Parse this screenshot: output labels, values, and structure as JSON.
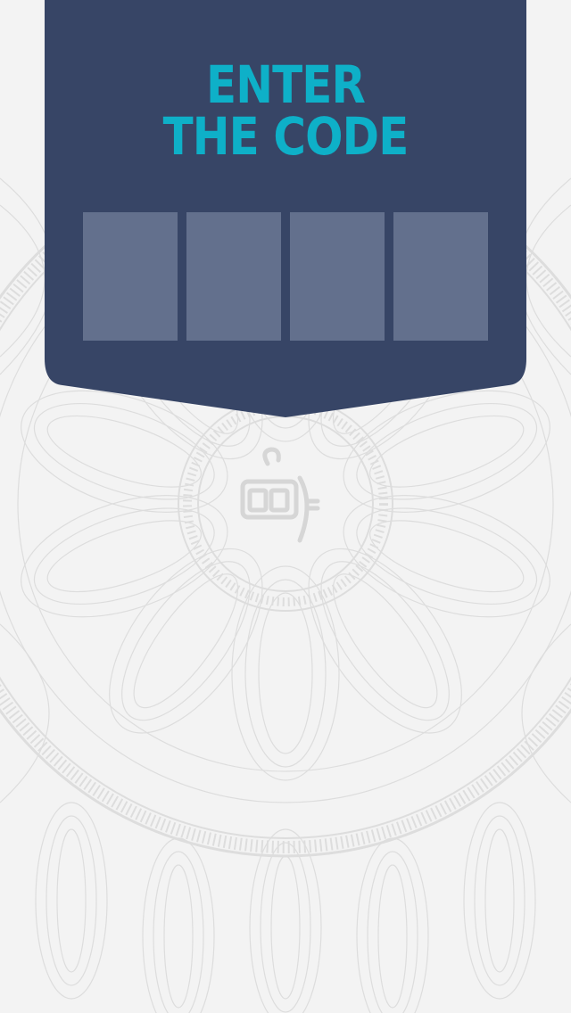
{
  "screen": {
    "title_line1": "ENTER",
    "title_line2": "THE CODE"
  },
  "code_input": {
    "digits": [
      "",
      "",
      "",
      ""
    ]
  },
  "emblem": {
    "icon": "slot-machine-icon"
  },
  "colors": {
    "background": "#f3f3f3",
    "pattern": "#dcdcdc",
    "banner": "#374566",
    "title": "#0eb0c8",
    "code_box": "#63708d"
  }
}
